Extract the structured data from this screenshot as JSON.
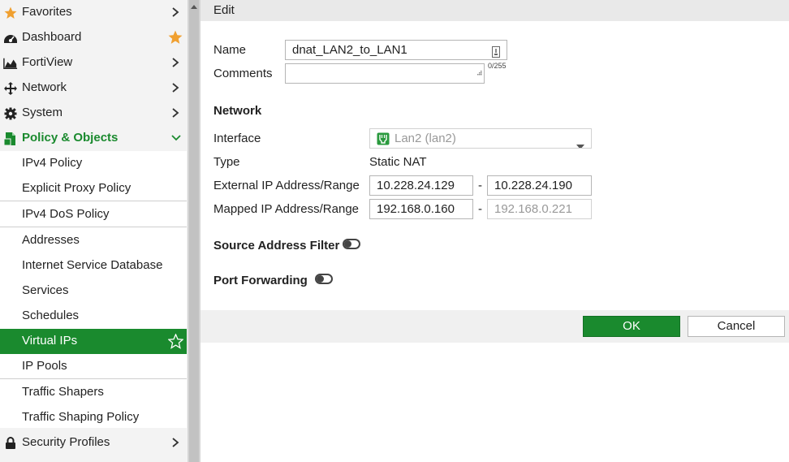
{
  "sidebar": {
    "favorites": "Favorites",
    "dashboard": "Dashboard",
    "fortiview": "FortiView",
    "network": "Network",
    "system": "System",
    "policy_objects": "Policy & Objects",
    "items": [
      "IPv4 Policy",
      "Explicit Proxy Policy",
      "IPv4 DoS Policy",
      "Addresses",
      "Internet Service Database",
      "Services",
      "Schedules",
      "Virtual IPs",
      "IP Pools",
      "Traffic Shapers",
      "Traffic Shaping Policy"
    ],
    "security_profiles": "Security Profiles"
  },
  "header": {
    "title": "Edit"
  },
  "form": {
    "name_label": "Name",
    "name_value": "dnat_LAN2_to_LAN1",
    "comments_label": "Comments",
    "comments_value": "",
    "comments_counter": "0/255",
    "network_section": "Network",
    "interface_label": "Interface",
    "interface_value": "Lan2 (lan2)",
    "type_label": "Type",
    "type_value": "Static NAT",
    "external_label": "External IP Address/Range",
    "external_start": "10.228.24.129",
    "external_end": "10.228.24.190",
    "range_dash": "-",
    "mapped_label": "Mapped IP Address/Range",
    "mapped_start": "192.168.0.160",
    "mapped_end": "192.168.0.221",
    "source_filter_label": "Source Address Filter",
    "port_forwarding_label": "Port Forwarding"
  },
  "buttons": {
    "ok": "OK",
    "cancel": "Cancel"
  },
  "colors": {
    "accent": "#1a8a2e",
    "star": "#f0a030"
  }
}
